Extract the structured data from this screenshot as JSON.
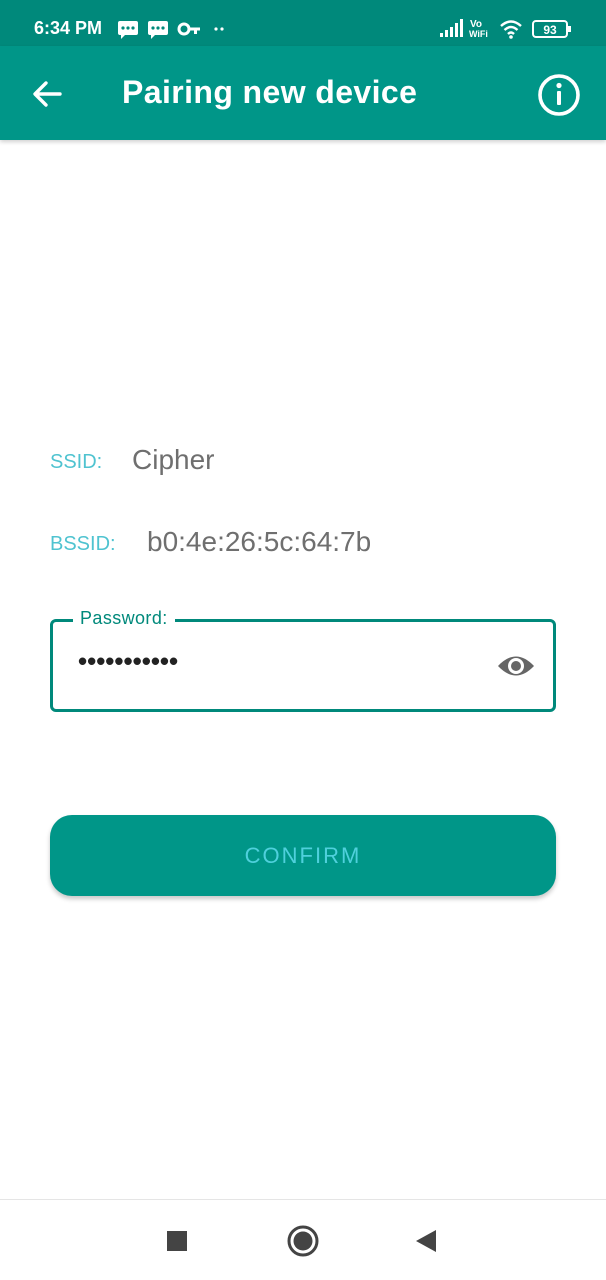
{
  "status_bar": {
    "time": "6:34 PM",
    "battery": "93",
    "network_label_top": "Vo",
    "network_label_bottom": "WiFi"
  },
  "app_bar": {
    "title": "Pairing new device",
    "back_icon": "arrow-back-icon",
    "info_icon": "info-icon"
  },
  "network": {
    "ssid_label": "SSID:",
    "ssid_value": "Cipher",
    "bssid_label": "BSSID:",
    "bssid_value": "b0:4e:26:5c:64:7b"
  },
  "password": {
    "label": "Password:",
    "masked_value": "•••••••••••",
    "toggle_icon": "eye-icon"
  },
  "confirm_label": "CONFIRM",
  "colors": {
    "primary": "#009688",
    "primary_dark": "#00897b",
    "label_accent": "#4fc3d0",
    "button_text": "#4fd0dc"
  },
  "nav_bar": {
    "recents_icon": "square-icon",
    "home_icon": "circle-icon",
    "back_icon": "triangle-back-icon"
  }
}
